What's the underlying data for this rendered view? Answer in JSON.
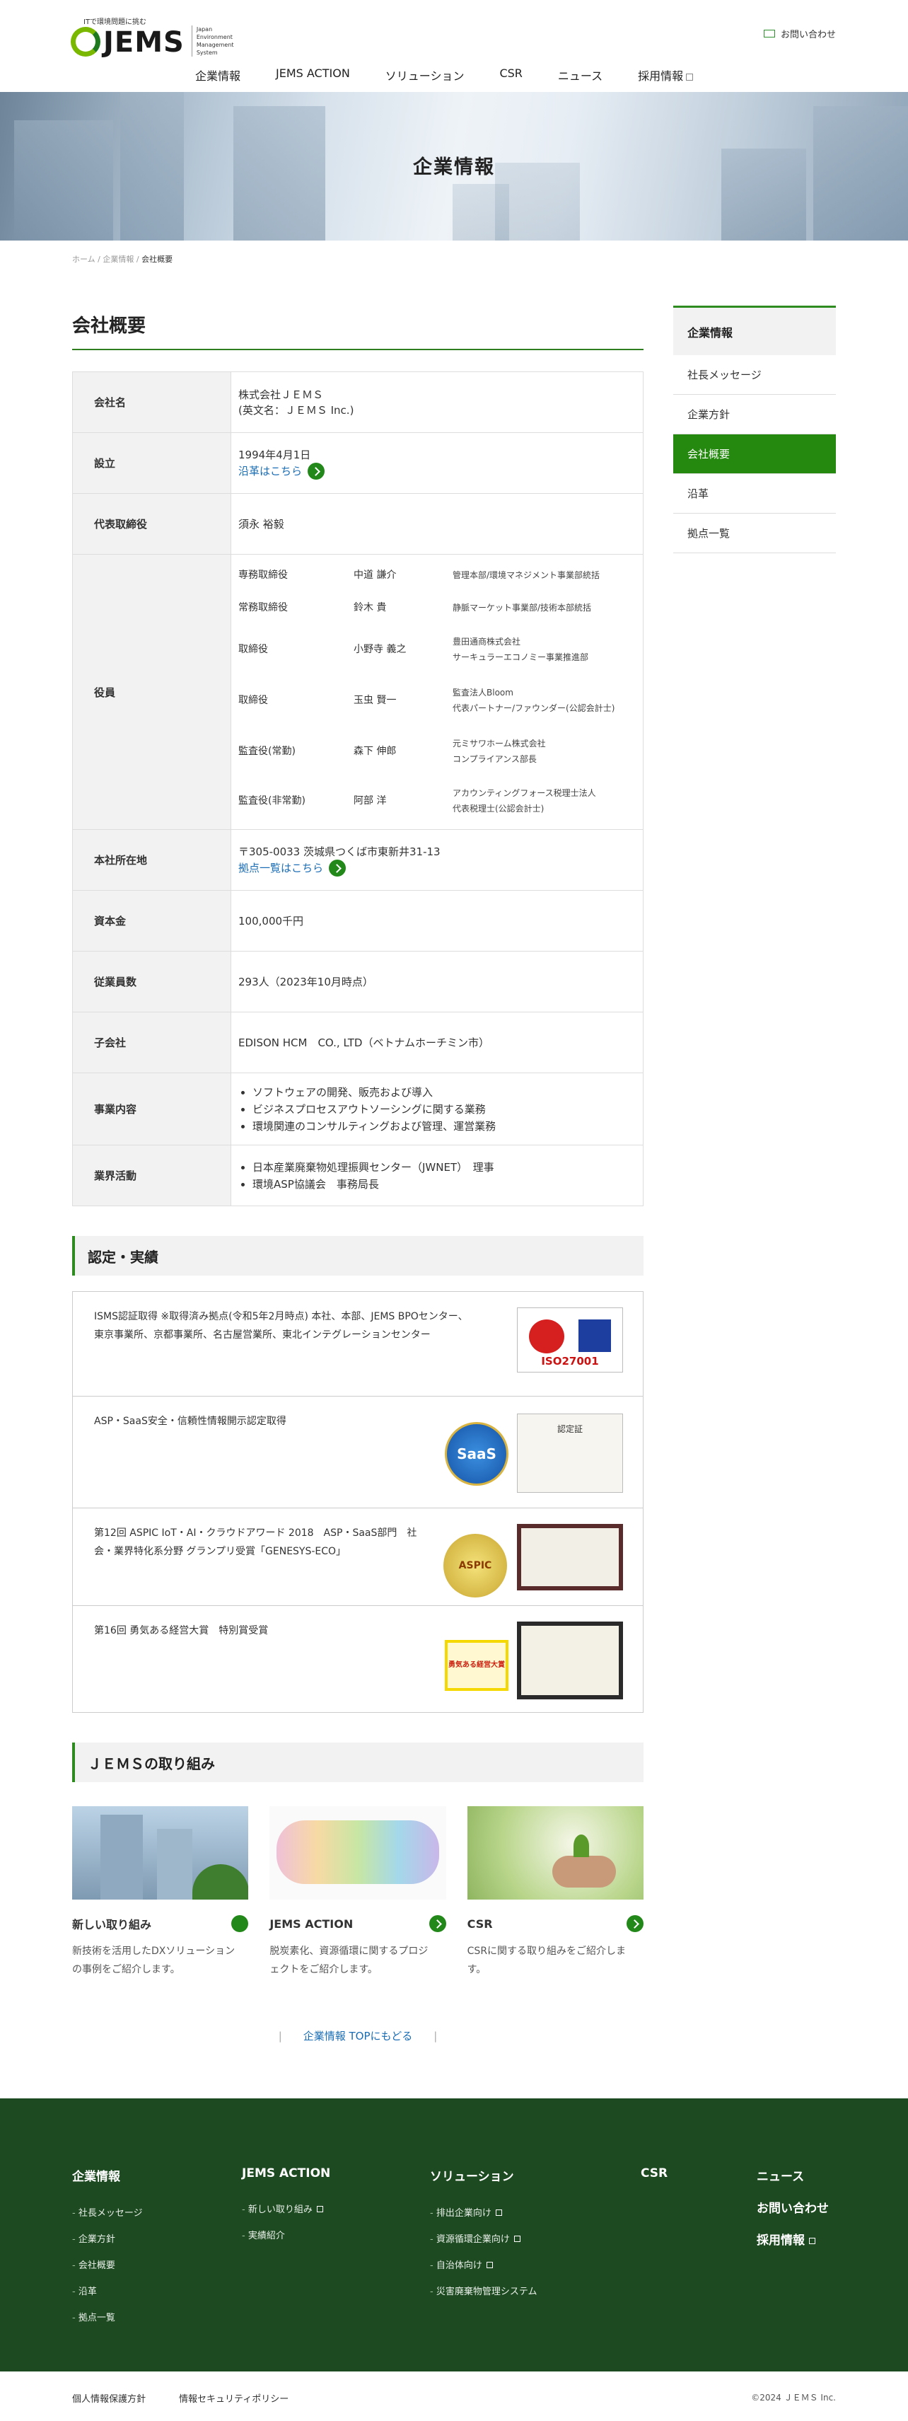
{
  "header": {
    "logo_tagline": "ITで環境問題に挑む",
    "logo_text": "JEMS",
    "logo_sub": [
      "Japan",
      "Environment",
      "Management",
      "System"
    ],
    "contact": "お問い合わせ",
    "nav": [
      "企業情報",
      "JEMS ACTION",
      "ソリューション",
      "CSR",
      "ニュース",
      "採用情報"
    ]
  },
  "hero": {
    "title": "企業情報"
  },
  "breadcrumb": [
    "ホーム",
    "企業情報",
    "会社概要"
  ],
  "page_title": "会社概要",
  "company": {
    "name_label": "会社名",
    "name_line1": "株式会社ＪＥＭＳ",
    "name_line2": "(英文名：ＪＥＭＳ Inc.)",
    "established_label": "設立",
    "established": "1994年4月1日",
    "history_link": "沿革はこちら",
    "representative_label": "代表取締役",
    "representative": "須永 裕毅",
    "officers_label": "役員",
    "officers": [
      {
        "role": "専務取締役",
        "name": "中道 謙介",
        "p1": "管理本部/環境マネジメント事業部統括",
        "p2": ""
      },
      {
        "role": "常務取締役",
        "name": "鈴木 貴",
        "p1": "静脈マーケット事業部/技術本部統括",
        "p2": ""
      },
      {
        "role": "取締役",
        "name": "小野寺 義之",
        "p1": "豊田通商株式会社",
        "p2": "サーキュラーエコノミー事業推進部"
      },
      {
        "role": "取締役",
        "name": "玉虫 賢一",
        "p1": "監査法人Bloom",
        "p2": "代表パートナー/ファウンダー(公認会計士)"
      },
      {
        "role": "監査役(常勤)",
        "name": "森下 伸郎",
        "p1": "元ミサワホーム株式会社",
        "p2": "コンプライアンス部長"
      },
      {
        "role": "監査役(非常勤)",
        "name": "阿部 洋",
        "p1": "アカウンティングフォース税理士法人",
        "p2": "代表税理士(公認会計士)"
      }
    ],
    "address_label": "本社所在地",
    "address": "〒305-0033 茨城県つくば市東新井31-13",
    "office_link": "拠点一覧はこちら",
    "capital_label": "資本金",
    "capital": "100,000千円",
    "employees_label": "従業員数",
    "employees": "293人（2023年10月時点）",
    "subsidiary_label": "子会社",
    "subsidiary": "EDISON HCM　CO., LTD（ベトナムホーチミン市）",
    "business_label": "事業内容",
    "business": [
      "ソフトウェアの開発、販売および導入",
      "ビジネスプロセスアウトソーシングに関する業務",
      "環境関連のコンサルティングおよび管理、運営業務"
    ],
    "industry_label": "業界活動",
    "industry": [
      "日本産業廃棄物処理振興センター（JWNET）　理事",
      "環境ASP協議会　事務局長"
    ]
  },
  "certs": {
    "heading": "認定・実績",
    "items": [
      {
        "line1": "ISMS認証取得 ※取得済み拠点(令和5年2月時点) 本社、本部、JEMS BPOセンター、",
        "line2": "東京事業所、京都事業所、名古屋営業所、東北インテグレーションセンター"
      },
      {
        "line1": "ASP・SaaS安全・信頼性情報開示認定取得",
        "line2": ""
      },
      {
        "line1": "第12回 ASPIC IoT・AI・クラウドアワード 2018　ASP・SaaS部門　社",
        "line2": "会・業界特化系分野 グランプリ受賞「GENESYS-ECO」"
      },
      {
        "line1": "第16回 勇気ある経営大賞　特別賞受賞",
        "line2": ""
      }
    ],
    "iso_label": "ISO27001",
    "saas_label": "SaaS",
    "aspic_label": "ASPIC",
    "courage_label": "勇気ある経営大賞",
    "certificate_label": "認定証"
  },
  "works": {
    "heading": "ＪＥＭＳの取り組み",
    "items": [
      {
        "title": "新しい取り組み",
        "desc1": "新技術を活用したDXソリューション",
        "desc2": "の事例をご紹介します。"
      },
      {
        "title": "JEMS ACTION",
        "desc1": "脱炭素化、資源循環に関するプロジ",
        "desc2": "ェクトをご紹介します。"
      },
      {
        "title": "CSR",
        "desc1": "CSRに関する取り組みをご紹介しま",
        "desc2": "す。"
      }
    ],
    "back_link": "企業情報 TOPにもどる"
  },
  "side": {
    "title": "企業情報",
    "items": [
      "社長メッセージ",
      "企業方針",
      "会社概要",
      "沿革",
      "拠点一覧"
    ],
    "active": 2
  },
  "footer": {
    "col1": {
      "title": "企業情報",
      "items": [
        "社長メッセージ",
        "企業方針",
        "会社概要",
        "沿革",
        "拠点一覧"
      ]
    },
    "col2": {
      "title": "JEMS ACTION",
      "items": [
        "新しい取り組み",
        "実績紹介"
      ]
    },
    "col3": {
      "title": "ソリューション",
      "items": [
        "排出企業向け",
        "資源循環企業向け",
        "自治体向け",
        "災害廃棄物管理システム"
      ]
    },
    "col4": {
      "title": "CSR"
    },
    "col5": {
      "news": "ニュース",
      "contact": "お問い合わせ",
      "recruit": "採用情報"
    }
  },
  "bottom": {
    "privacy": "個人情報保護方針",
    "security": "情報セキュリティポリシー",
    "copyright": "©2024 ＪＥＭＳ Inc."
  },
  "colors": {
    "accent": "#24890e",
    "footer": "#1d4a21",
    "link": "#1a6db5"
  }
}
